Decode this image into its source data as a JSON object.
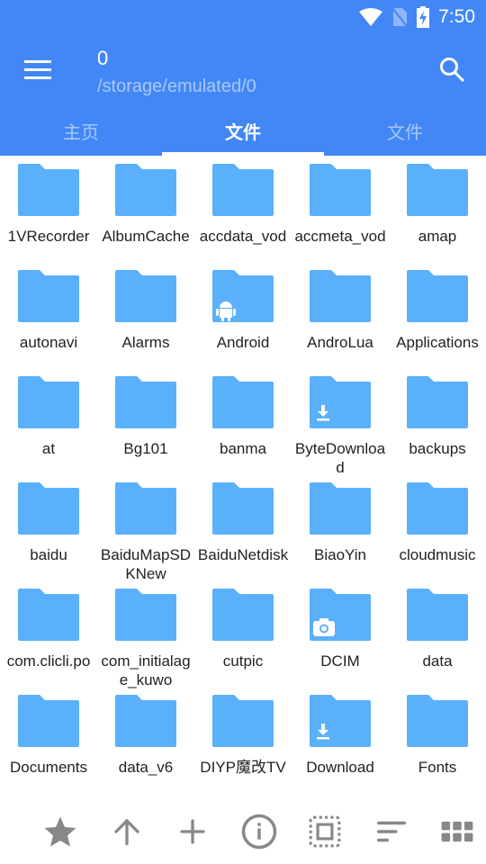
{
  "status": {
    "time": "7:50",
    "icons": [
      "wifi-icon",
      "no-sim-icon",
      "battery-charging-icon"
    ]
  },
  "header": {
    "title": "0",
    "path": "/storage/emulated/0",
    "menu_icon": "menu-icon",
    "search_icon": "search-icon"
  },
  "tabs": [
    {
      "label": "主页"
    },
    {
      "label": "文件",
      "active": true
    },
    {
      "label": "文件"
    }
  ],
  "colors": {
    "primary": "#4287f5",
    "folder": "#5ab0fb",
    "icon_gray": "#888888"
  },
  "files": [
    {
      "name": "1VRecorder"
    },
    {
      "name": "AlbumCache"
    },
    {
      "name": "accdata_vod"
    },
    {
      "name": "accmeta_vod"
    },
    {
      "name": "amap"
    },
    {
      "name": "autonavi"
    },
    {
      "name": "Alarms"
    },
    {
      "name": "Android",
      "badge": "android"
    },
    {
      "name": "AndroLua"
    },
    {
      "name": "Applications"
    },
    {
      "name": "at"
    },
    {
      "name": "Bg101"
    },
    {
      "name": "banma"
    },
    {
      "name": "ByteDownload",
      "badge": "download"
    },
    {
      "name": "backups"
    },
    {
      "name": "baidu"
    },
    {
      "name": "BaiduMapSDKNew"
    },
    {
      "name": "BaiduNetdisk"
    },
    {
      "name": "BiaoYin"
    },
    {
      "name": "cloudmusic"
    },
    {
      "name": "com.clicli.po"
    },
    {
      "name": "com_initialage_kuwo"
    },
    {
      "name": "cutpic"
    },
    {
      "name": "DCIM",
      "badge": "camera"
    },
    {
      "name": "data"
    },
    {
      "name": "Documents"
    },
    {
      "name": "data_v6"
    },
    {
      "name": "DIYP魔改TV"
    },
    {
      "name": "Download",
      "badge": "download"
    },
    {
      "name": "Fonts"
    }
  ],
  "toolbar": [
    "star-icon",
    "arrow-up-icon",
    "add-icon",
    "info-icon",
    "select-all-icon",
    "sort-icon",
    "grid-view-icon"
  ]
}
